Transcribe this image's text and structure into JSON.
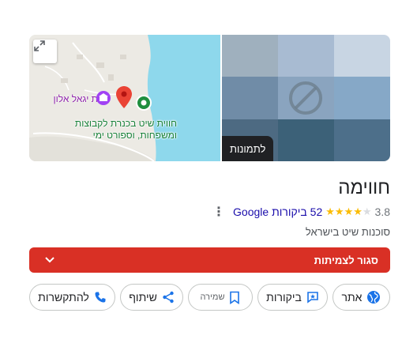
{
  "place": {
    "title": "חווימה",
    "rating": "3.8",
    "stars_filled": 4,
    "stars_total": 5,
    "reviews_text": "52 ביקורות Google",
    "category": "סוכנות שיט בישראל"
  },
  "map": {
    "poi_label": "בית יגאל אלון",
    "place_label_line1": "חווית שיט בכנרת לקבוצות",
    "place_label_line2": "ומשפחות, וספורט ימי"
  },
  "photos": {
    "chip_label": "לתמונות"
  },
  "status": {
    "text": "סגור לצמיתות",
    "color": "#d93025"
  },
  "actions": {
    "website": "אתר",
    "reviews": "ביקורות",
    "save": "שמירה",
    "share": "שיתוף",
    "call": "להתקשרות"
  },
  "colors": {
    "water": "#8ed8ec",
    "accent_blue": "#1a73e8",
    "star": "#fbbc04",
    "link": "#1a0dab"
  }
}
